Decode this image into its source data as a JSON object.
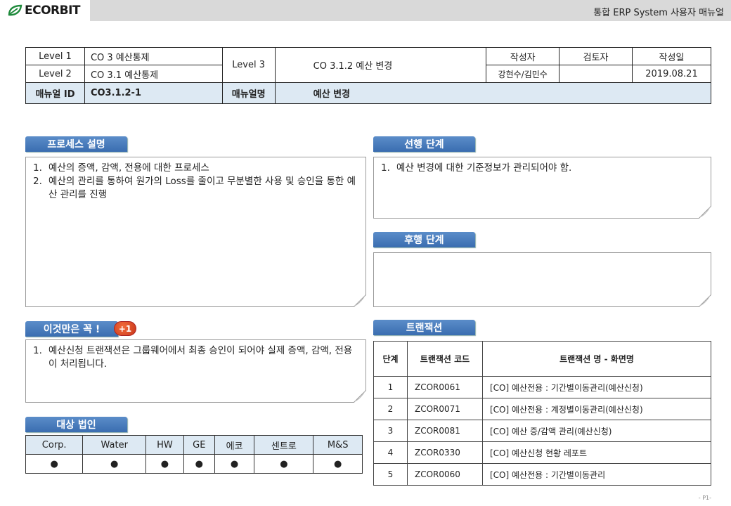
{
  "header": {
    "brand": "ECORBIT",
    "doc_title": "통합 ERP System 사용자 매뉴얼"
  },
  "info": {
    "level1_label": "Level 1",
    "level1_value": "CO 3 예산통제",
    "level2_label": "Level 2",
    "level2_value": "CO 3.1 예산통제",
    "level3_label": "Level 3",
    "level3_value": "CO 3.1.2 예산 변경",
    "author_label": "작성자",
    "reviewer_label": "검토자",
    "date_label": "작성일",
    "author_value": "강현수/김민수",
    "reviewer_value": "",
    "date_value": "2019.08.21",
    "manual_id_label": "매뉴얼 ID",
    "manual_id_value": "CO3.1.2-1",
    "manual_desc_label": "매뉴얼명",
    "manual_desc_value": "예산 변경"
  },
  "process": {
    "label": "프로세스 설명",
    "items": [
      {
        "num": "1.",
        "text": "예산의 증액, 감액, 전용에 대한 프로세스"
      },
      {
        "num": "2.",
        "text": "예산의 관리를 통하여 원가의 Loss를 줄이고 무분별한 사용 및 승인을 통한 예산 관리를 진행"
      }
    ]
  },
  "prerequisite": {
    "label": "선행 단계",
    "items": [
      {
        "num": "1.",
        "text": "예산 변경에 대한 기준정보가 관리되어야 함."
      }
    ]
  },
  "followup": {
    "label": "후행 단계",
    "items": []
  },
  "must_know": {
    "label": "이것만은 꼭 !",
    "badge": "+1",
    "items": [
      {
        "num": "1.",
        "text": "예산신청 트랜잭션은 그룹웨어에서 최종 승인이 되어야 실제 증액, 감액, 전용이 처리됩니다."
      }
    ]
  },
  "target_corp": {
    "label": "대상 법인",
    "columns": [
      "Corp.",
      "Water",
      "HW",
      "GE",
      "에코",
      "센트로",
      "M&S"
    ],
    "marks": [
      "●",
      "●",
      "●",
      "●",
      "●",
      "●",
      "●"
    ]
  },
  "transactions": {
    "label": "트랜잭션",
    "headers": [
      "단계",
      "트랜잭션 코드",
      "트랜잭션 명 - 화면명"
    ],
    "rows": [
      {
        "step": "1",
        "code": "ZCOR0061",
        "name": "[CO] 예산전용 : 기간별이동관리(예산신청)"
      },
      {
        "step": "2",
        "code": "ZCOR0071",
        "name": "[CO] 예산전용 : 계정별이동관리(예산신청)"
      },
      {
        "step": "3",
        "code": "ZCOR0081",
        "name": "[CO] 예산 증/감액 관리(예산신청)"
      },
      {
        "step": "4",
        "code": "ZCOR0330",
        "name": "[CO] 예산신청 현황 레포트"
      },
      {
        "step": "5",
        "code": "ZCOR0060",
        "name": "[CO] 예산전용 : 기간별이동관리"
      }
    ]
  },
  "footer": {
    "page": "- P1-"
  },
  "colors": {
    "tab_blue": "#3a6db0",
    "header_gray": "#d9d9d9",
    "table_highlight": "#dde9f3",
    "brand_green": "#1f8a3c"
  }
}
